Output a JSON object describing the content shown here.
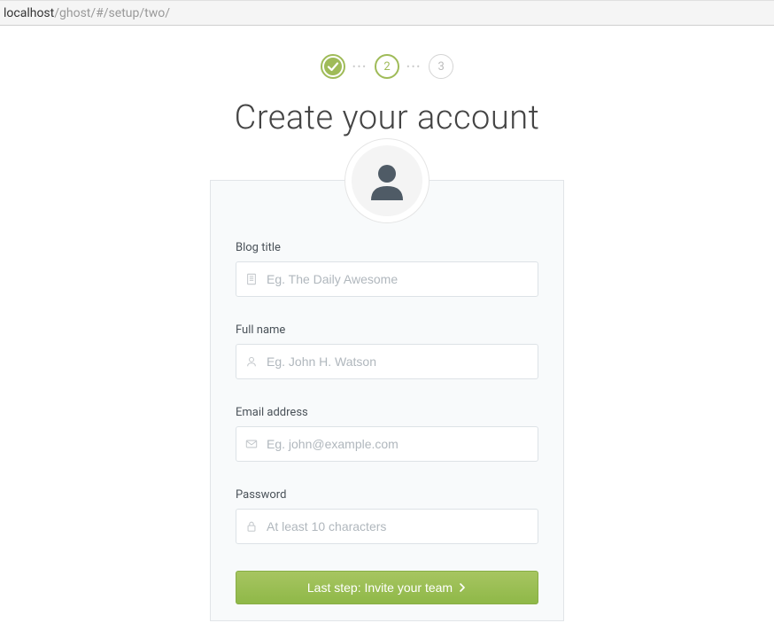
{
  "address": {
    "host": "localhost",
    "path": "/ghost/#/setup/two/"
  },
  "stepper": {
    "step2_label": "2",
    "step3_label": "3"
  },
  "title": "Create your account",
  "form": {
    "blog_title": {
      "label": "Blog title",
      "placeholder": "Eg. The Daily Awesome",
      "value": ""
    },
    "full_name": {
      "label": "Full name",
      "placeholder": "Eg. John H. Watson",
      "value": ""
    },
    "email": {
      "label": "Email address",
      "placeholder": "Eg. john@example.com",
      "value": ""
    },
    "password": {
      "label": "Password",
      "placeholder": "At least 10 characters",
      "value": ""
    },
    "submit_label": "Last step: Invite your team"
  }
}
